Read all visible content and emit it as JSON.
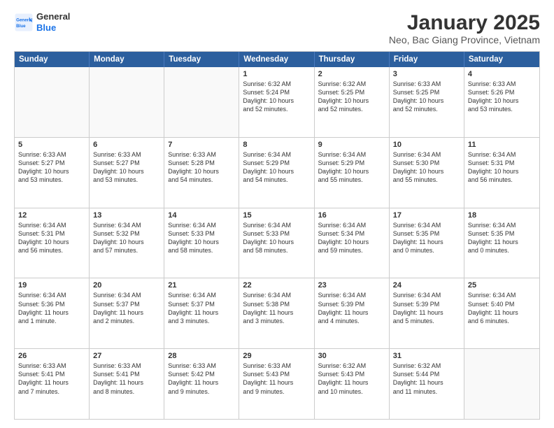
{
  "logo": {
    "line1": "General",
    "line2": "Blue"
  },
  "title": "January 2025",
  "subtitle": "Neo, Bac Giang Province, Vietnam",
  "header_days": [
    "Sunday",
    "Monday",
    "Tuesday",
    "Wednesday",
    "Thursday",
    "Friday",
    "Saturday"
  ],
  "weeks": [
    [
      {
        "day": "",
        "text": ""
      },
      {
        "day": "",
        "text": ""
      },
      {
        "day": "",
        "text": ""
      },
      {
        "day": "1",
        "text": "Sunrise: 6:32 AM\nSunset: 5:24 PM\nDaylight: 10 hours\nand 52 minutes."
      },
      {
        "day": "2",
        "text": "Sunrise: 6:32 AM\nSunset: 5:25 PM\nDaylight: 10 hours\nand 52 minutes."
      },
      {
        "day": "3",
        "text": "Sunrise: 6:33 AM\nSunset: 5:25 PM\nDaylight: 10 hours\nand 52 minutes."
      },
      {
        "day": "4",
        "text": "Sunrise: 6:33 AM\nSunset: 5:26 PM\nDaylight: 10 hours\nand 53 minutes."
      }
    ],
    [
      {
        "day": "5",
        "text": "Sunrise: 6:33 AM\nSunset: 5:27 PM\nDaylight: 10 hours\nand 53 minutes."
      },
      {
        "day": "6",
        "text": "Sunrise: 6:33 AM\nSunset: 5:27 PM\nDaylight: 10 hours\nand 53 minutes."
      },
      {
        "day": "7",
        "text": "Sunrise: 6:33 AM\nSunset: 5:28 PM\nDaylight: 10 hours\nand 54 minutes."
      },
      {
        "day": "8",
        "text": "Sunrise: 6:34 AM\nSunset: 5:29 PM\nDaylight: 10 hours\nand 54 minutes."
      },
      {
        "day": "9",
        "text": "Sunrise: 6:34 AM\nSunset: 5:29 PM\nDaylight: 10 hours\nand 55 minutes."
      },
      {
        "day": "10",
        "text": "Sunrise: 6:34 AM\nSunset: 5:30 PM\nDaylight: 10 hours\nand 55 minutes."
      },
      {
        "day": "11",
        "text": "Sunrise: 6:34 AM\nSunset: 5:31 PM\nDaylight: 10 hours\nand 56 minutes."
      }
    ],
    [
      {
        "day": "12",
        "text": "Sunrise: 6:34 AM\nSunset: 5:31 PM\nDaylight: 10 hours\nand 56 minutes."
      },
      {
        "day": "13",
        "text": "Sunrise: 6:34 AM\nSunset: 5:32 PM\nDaylight: 10 hours\nand 57 minutes."
      },
      {
        "day": "14",
        "text": "Sunrise: 6:34 AM\nSunset: 5:33 PM\nDaylight: 10 hours\nand 58 minutes."
      },
      {
        "day": "15",
        "text": "Sunrise: 6:34 AM\nSunset: 5:33 PM\nDaylight: 10 hours\nand 58 minutes."
      },
      {
        "day": "16",
        "text": "Sunrise: 6:34 AM\nSunset: 5:34 PM\nDaylight: 10 hours\nand 59 minutes."
      },
      {
        "day": "17",
        "text": "Sunrise: 6:34 AM\nSunset: 5:35 PM\nDaylight: 11 hours\nand 0 minutes."
      },
      {
        "day": "18",
        "text": "Sunrise: 6:34 AM\nSunset: 5:35 PM\nDaylight: 11 hours\nand 0 minutes."
      }
    ],
    [
      {
        "day": "19",
        "text": "Sunrise: 6:34 AM\nSunset: 5:36 PM\nDaylight: 11 hours\nand 1 minute."
      },
      {
        "day": "20",
        "text": "Sunrise: 6:34 AM\nSunset: 5:37 PM\nDaylight: 11 hours\nand 2 minutes."
      },
      {
        "day": "21",
        "text": "Sunrise: 6:34 AM\nSunset: 5:37 PM\nDaylight: 11 hours\nand 3 minutes."
      },
      {
        "day": "22",
        "text": "Sunrise: 6:34 AM\nSunset: 5:38 PM\nDaylight: 11 hours\nand 3 minutes."
      },
      {
        "day": "23",
        "text": "Sunrise: 6:34 AM\nSunset: 5:39 PM\nDaylight: 11 hours\nand 4 minutes."
      },
      {
        "day": "24",
        "text": "Sunrise: 6:34 AM\nSunset: 5:39 PM\nDaylight: 11 hours\nand 5 minutes."
      },
      {
        "day": "25",
        "text": "Sunrise: 6:34 AM\nSunset: 5:40 PM\nDaylight: 11 hours\nand 6 minutes."
      }
    ],
    [
      {
        "day": "26",
        "text": "Sunrise: 6:33 AM\nSunset: 5:41 PM\nDaylight: 11 hours\nand 7 minutes."
      },
      {
        "day": "27",
        "text": "Sunrise: 6:33 AM\nSunset: 5:41 PM\nDaylight: 11 hours\nand 8 minutes."
      },
      {
        "day": "28",
        "text": "Sunrise: 6:33 AM\nSunset: 5:42 PM\nDaylight: 11 hours\nand 9 minutes."
      },
      {
        "day": "29",
        "text": "Sunrise: 6:33 AM\nSunset: 5:43 PM\nDaylight: 11 hours\nand 9 minutes."
      },
      {
        "day": "30",
        "text": "Sunrise: 6:32 AM\nSunset: 5:43 PM\nDaylight: 11 hours\nand 10 minutes."
      },
      {
        "day": "31",
        "text": "Sunrise: 6:32 AM\nSunset: 5:44 PM\nDaylight: 11 hours\nand 11 minutes."
      },
      {
        "day": "",
        "text": ""
      }
    ]
  ]
}
